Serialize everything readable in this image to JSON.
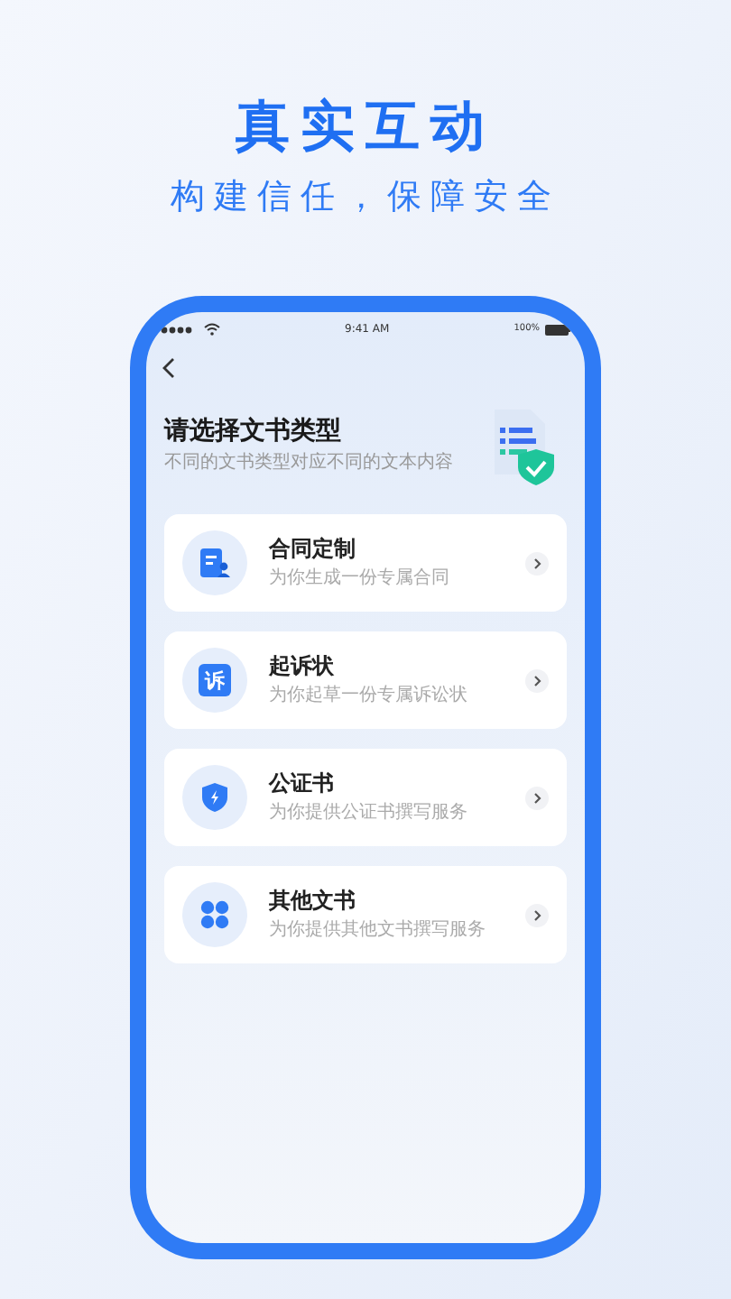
{
  "headline": "真实互动",
  "tagline": "构建信任，保障安全",
  "status_bar": {
    "time": "9:41 AM",
    "battery": "100%"
  },
  "page": {
    "title": "请选择文书类型",
    "subtitle": "不同的文书类型对应不同的文本内容"
  },
  "items": [
    {
      "kind": "contract",
      "title": "合同定制",
      "subtitle": "为你生成一份专属合同"
    },
    {
      "kind": "glyph",
      "glyph": "诉",
      "title": "起诉状",
      "subtitle": "为你起草一份专属诉讼状"
    },
    {
      "kind": "shield",
      "title": "公证书",
      "subtitle": "为你提供公证书撰写服务"
    },
    {
      "kind": "grid",
      "title": "其他文书",
      "subtitle": "为你提供其他文书撰写服务"
    }
  ]
}
